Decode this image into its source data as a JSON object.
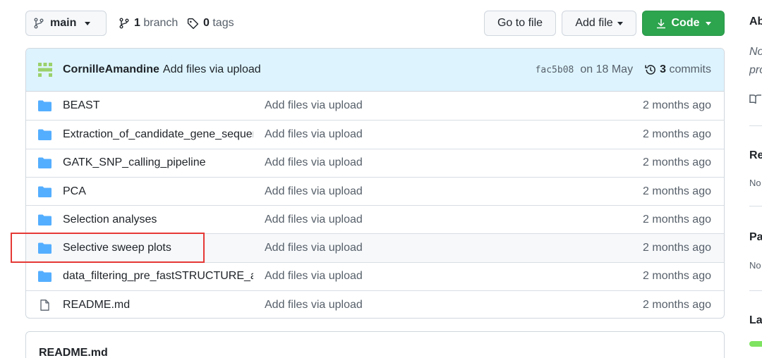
{
  "toolbar": {
    "branch_name": "main",
    "branches_count": "1",
    "branches_label": "branch",
    "tags_count": "0",
    "tags_label": "tags",
    "go_to_file": "Go to file",
    "add_file": "Add file",
    "code": "Code"
  },
  "latest_commit": {
    "author": "CornilleAmandine",
    "message": "Add files via upload",
    "sha": "fac5b08",
    "date": "on 18 May",
    "commits_count": "3",
    "commits_label": "commits"
  },
  "files": [
    {
      "name": "BEAST",
      "type": "folder",
      "message": "Add files via upload",
      "age": "2 months ago"
    },
    {
      "name": "Extraction_of_candidate_gene_sequen...",
      "type": "folder",
      "message": "Add files via upload",
      "age": "2 months ago"
    },
    {
      "name": "GATK_SNP_calling_pipeline",
      "type": "folder",
      "message": "Add files via upload",
      "age": "2 months ago"
    },
    {
      "name": "PCA",
      "type": "folder",
      "message": "Add files via upload",
      "age": "2 months ago"
    },
    {
      "name": "Selection analyses",
      "type": "folder",
      "message": "Add files via upload",
      "age": "2 months ago"
    },
    {
      "name": "Selective sweep plots",
      "type": "folder",
      "message": "Add files via upload",
      "age": "2 months ago"
    },
    {
      "name": "data_filtering_pre_fastSTRUCTURE_an...",
      "type": "folder",
      "message": "Add files via upload",
      "age": "2 months ago"
    },
    {
      "name": "README.md",
      "type": "file",
      "message": "Add files via upload",
      "age": "2 months ago"
    }
  ],
  "readme": {
    "title": "README.md"
  },
  "sidebar": {
    "about": "Ab",
    "desc_line1": "No",
    "desc_line2": "pro",
    "releases": "Re",
    "releases_note": "No",
    "packages": "Pa",
    "packages_note": "No",
    "languages": "La"
  },
  "colors": {
    "folder": "#54aeff",
    "code_button": "#2da44e",
    "commit_bar": "#ddf4ff",
    "highlight_box": "#e53935"
  }
}
